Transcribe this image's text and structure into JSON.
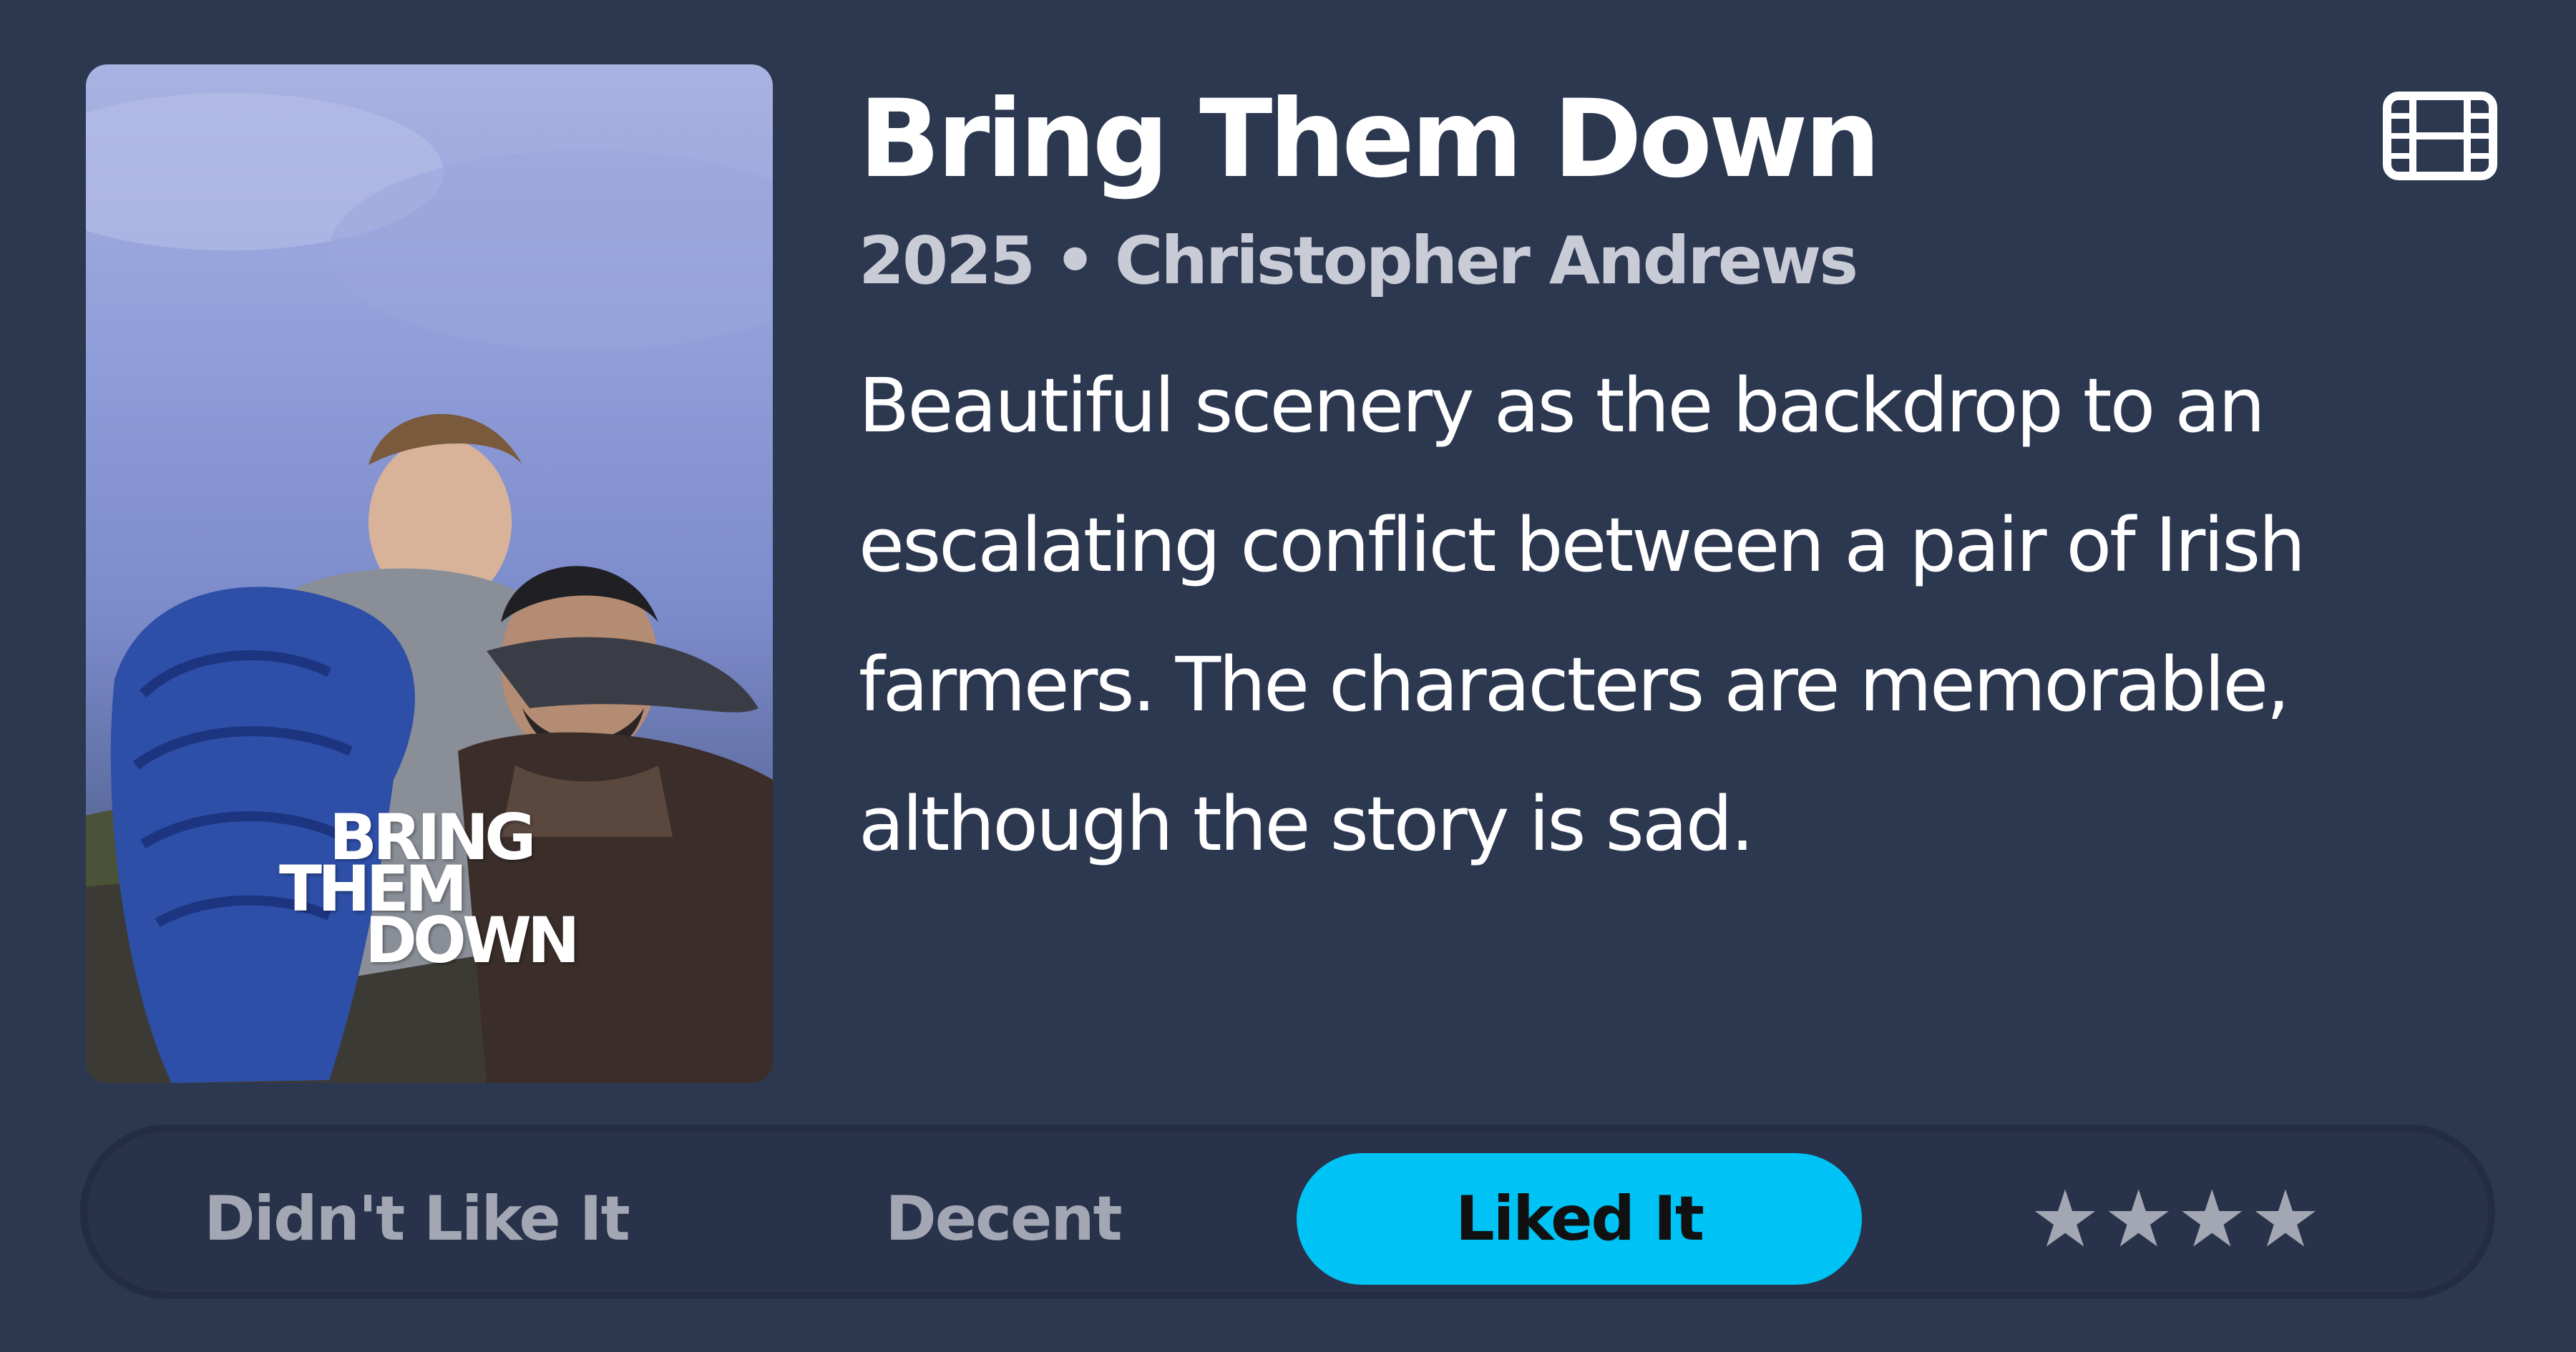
{
  "movie": {
    "title": "Bring Them Down",
    "subtitle": "2025 • Christopher Andrews",
    "review": "Beautiful scenery as the backdrop to an escalating conflict between a pair of Irish farmers. The characters are memorable, although the story is sad.",
    "poster": {
      "title_line1": "BRING",
      "title_line2": "THEM",
      "title_line3": "DOWN"
    }
  },
  "icons": {
    "film": "film-icon"
  },
  "rating": {
    "options": [
      {
        "label": "Didn't Like It"
      },
      {
        "label": "Decent"
      },
      {
        "label": "Liked It"
      },
      {
        "label": "★★★★"
      }
    ],
    "selected": "Liked It",
    "selected_color": "#00c3f5"
  },
  "colors": {
    "background": "#2c3750",
    "accent": "#00c3f5",
    "muted_text": "#a3a7b3"
  }
}
